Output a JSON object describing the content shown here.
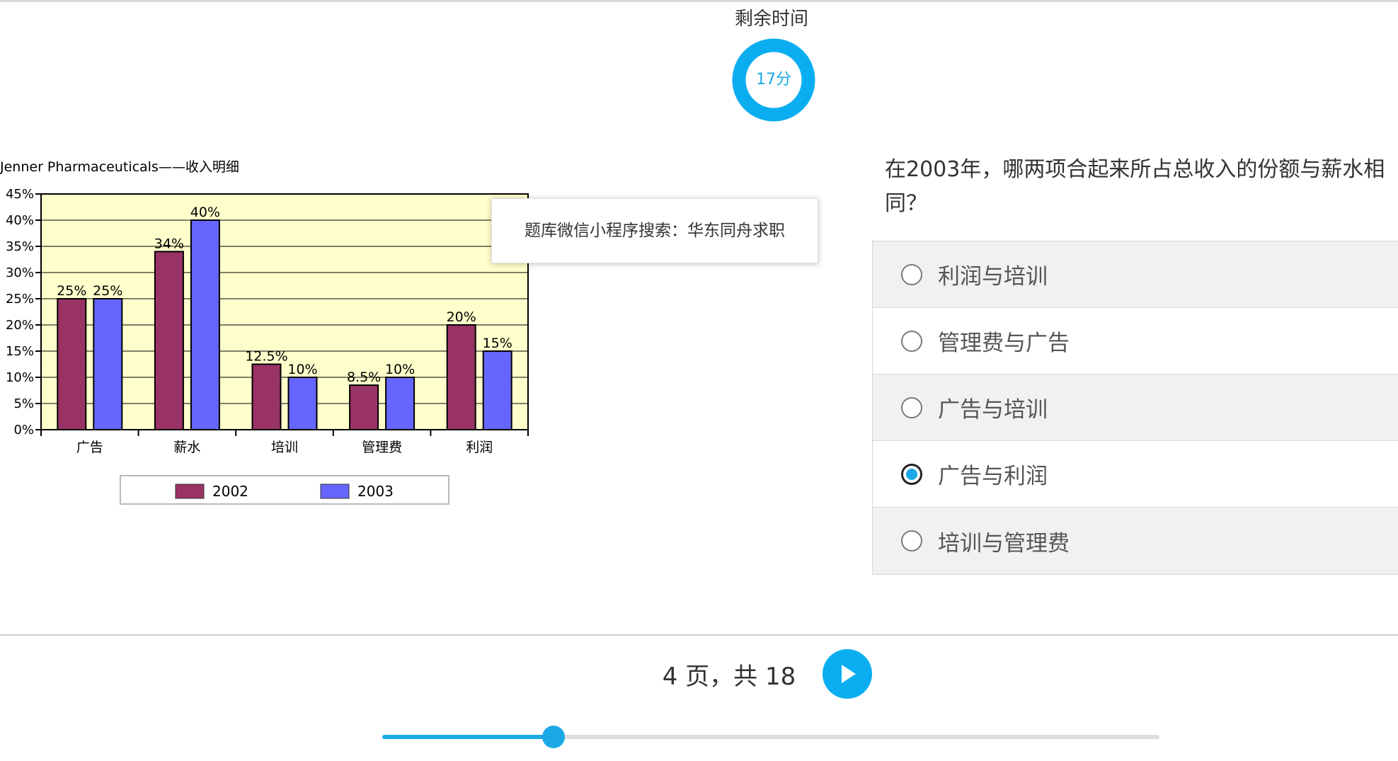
{
  "timer": {
    "label": "剩余时间",
    "value": "17分",
    "ring_color": "#0aaef0"
  },
  "watermark": {
    "text": "题库微信小程序搜索：华东同舟求职"
  },
  "chart_data": {
    "type": "bar",
    "title": "Jenner Pharmaceuticals——收入明细",
    "categories": [
      "广告",
      "薪水",
      "培训",
      "管理费",
      "利润"
    ],
    "series": [
      {
        "name": "2002",
        "values": [
          25,
          34,
          12.5,
          8.5,
          20
        ],
        "labels": [
          "25%",
          "34%",
          "12.5%",
          "8.5%",
          "20%"
        ],
        "color": "#993366"
      },
      {
        "name": "2003",
        "values": [
          25,
          40,
          10,
          10,
          15
        ],
        "labels": [
          "25%",
          "40%",
          "10%",
          "10%",
          "15%"
        ],
        "color": "#6666ff"
      }
    ],
    "y_ticks": [
      "0%",
      "5%",
      "10%",
      "15%",
      "20%",
      "25%",
      "30%",
      "35%",
      "40%",
      "45%"
    ],
    "ylim": [
      0,
      45
    ],
    "grid": true,
    "plot_background": "#ffffcc",
    "legend_position": "bottom"
  },
  "question": {
    "text": "在2003年，哪两项合起来所占总收入的份额与薪水相同？"
  },
  "options": [
    {
      "label": "利润与培训",
      "selected": false
    },
    {
      "label": "管理费与广告",
      "selected": false
    },
    {
      "label": "广告与培训",
      "selected": false
    },
    {
      "label": "广告与利润",
      "selected": true
    },
    {
      "label": "培训与管理费",
      "selected": false
    }
  ],
  "pagination": {
    "text": "4 页，共 18",
    "current": 4,
    "total": 18,
    "progress": 0.22
  },
  "colors": {
    "accent": "#1aa9e6"
  }
}
